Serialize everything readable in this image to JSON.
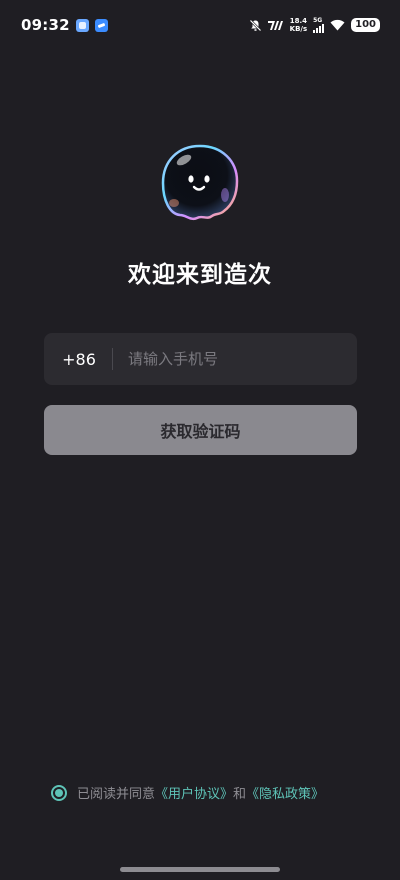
{
  "status_bar": {
    "time": "09:32",
    "speed_value": "18.4",
    "speed_unit": "KB/s",
    "network": "5G",
    "battery": "100",
    "icons": [
      "app-icon-1",
      "app-icon-2",
      "mute-bell-icon",
      "signal-hd-icon",
      "cellular-signal-icon",
      "wifi-icon",
      "battery-icon"
    ]
  },
  "welcome_title": "欢迎来到造次",
  "login": {
    "country_code": "+86",
    "phone_placeholder": "请输入手机号",
    "phone_value": "",
    "get_code_label": "获取验证码"
  },
  "agreement": {
    "checked": true,
    "prefix": "已阅读并同意",
    "user_agreement": "《用户协议》",
    "conjunction": "和",
    "privacy_policy": "《隐私政策》"
  },
  "colors": {
    "background": "#1f1e23",
    "input_bg": "#2c2b30",
    "button_bg": "#8a898f",
    "accent": "#5ec3b7"
  }
}
